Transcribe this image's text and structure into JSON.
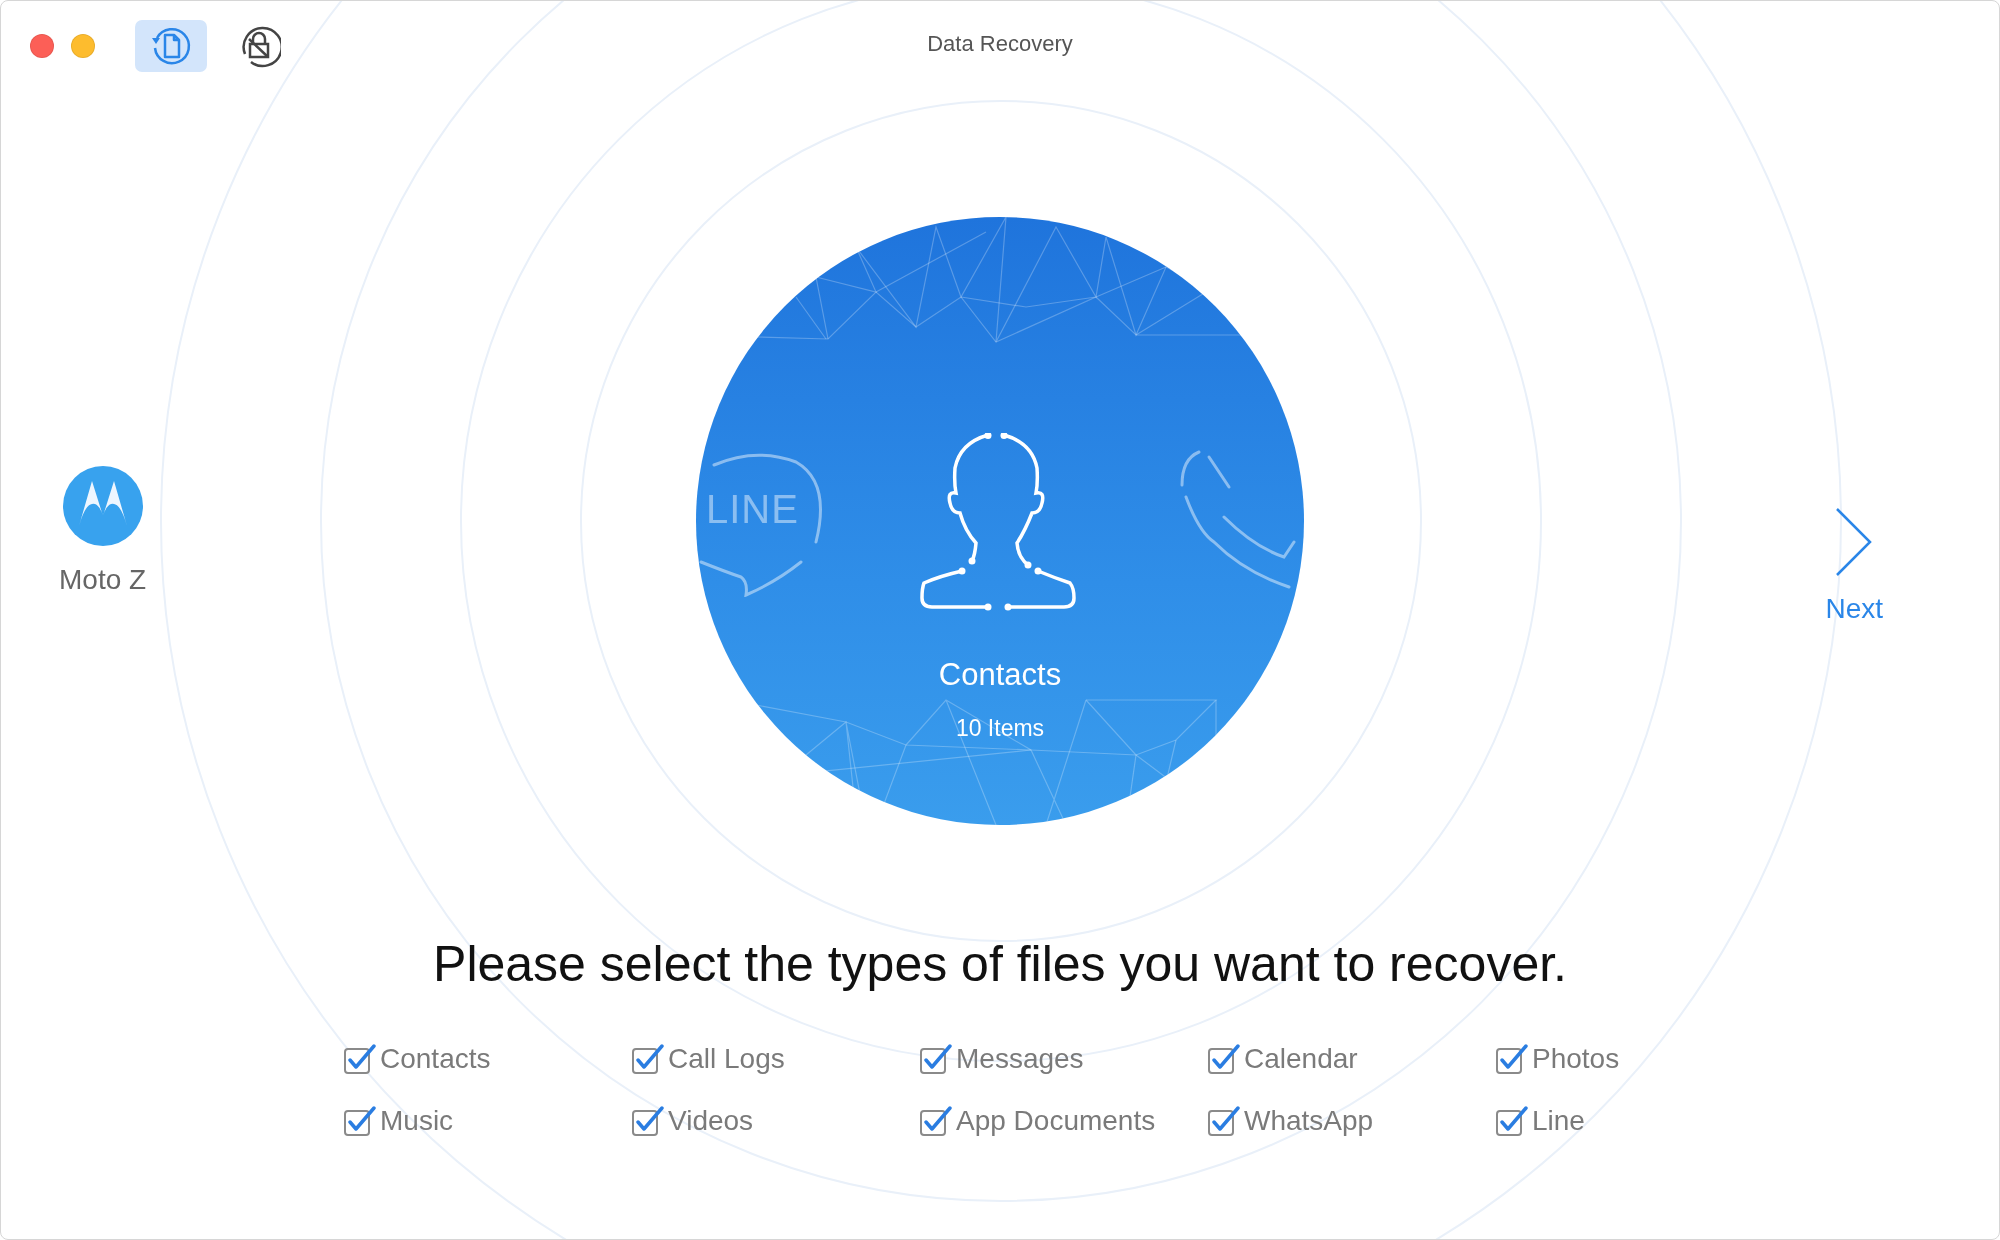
{
  "window": {
    "title": "Data Recovery"
  },
  "toolbar": [
    {
      "kind": "recover",
      "selected": true
    },
    {
      "kind": "unlock",
      "selected": false
    }
  ],
  "device": {
    "name": "Moto Z"
  },
  "featured": {
    "badge": "LINE",
    "title": "Contacts",
    "count": "10 Items"
  },
  "next": {
    "label": "Next"
  },
  "heading": "Please select the types of files you want to recover.",
  "file_types": [
    {
      "label": "Contacts",
      "checked": true
    },
    {
      "label": "Call Logs",
      "checked": true
    },
    {
      "label": "Messages",
      "checked": true
    },
    {
      "label": "Calendar",
      "checked": true
    },
    {
      "label": "Photos",
      "checked": true
    },
    {
      "label": "Music",
      "checked": true
    },
    {
      "label": "Videos",
      "checked": true
    },
    {
      "label": "App Documents",
      "checked": true
    },
    {
      "label": "WhatsApp",
      "checked": true
    },
    {
      "label": "Line",
      "checked": true
    }
  ]
}
